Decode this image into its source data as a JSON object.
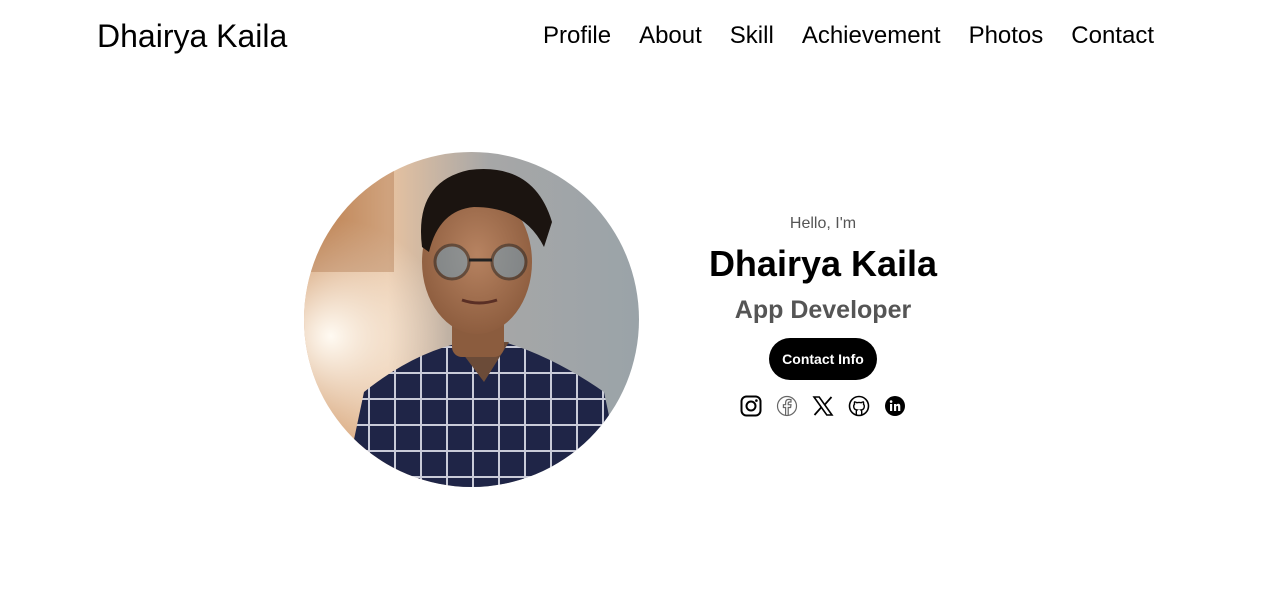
{
  "header": {
    "logo": "Dhairya Kaila",
    "nav": {
      "profile": "Profile",
      "about": "About",
      "skill": "Skill",
      "achievement": "Achievement",
      "photos": "Photos",
      "contact": "Contact"
    }
  },
  "hero": {
    "greeting": "Hello, I'm",
    "name": "Dhairya Kaila",
    "role": "App Developer",
    "contact_button": "Contact Info",
    "socials": [
      "instagram-icon",
      "facebook-icon",
      "x-icon",
      "github-icon",
      "linkedin-icon"
    ]
  },
  "colors": {
    "text": "#000000",
    "muted": "#555555",
    "button_bg": "#000000",
    "button_text": "#ffffff",
    "background": "#ffffff"
  }
}
